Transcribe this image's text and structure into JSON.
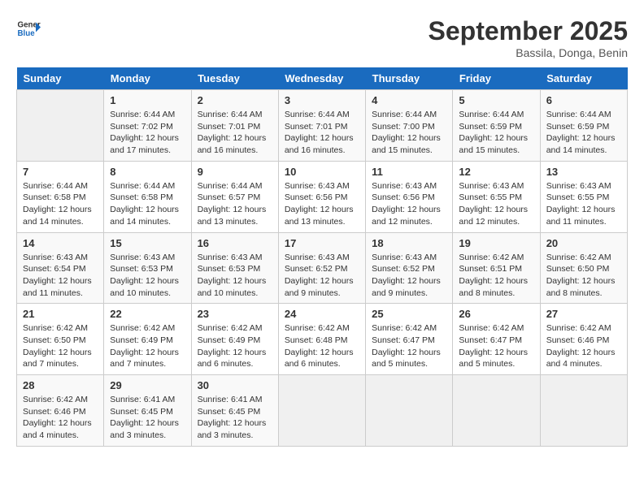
{
  "header": {
    "logo_line1": "General",
    "logo_line2": "Blue",
    "month": "September 2025",
    "location": "Bassila, Donga, Benin"
  },
  "days_of_week": [
    "Sunday",
    "Monday",
    "Tuesday",
    "Wednesday",
    "Thursday",
    "Friday",
    "Saturday"
  ],
  "weeks": [
    [
      {
        "num": "",
        "info": ""
      },
      {
        "num": "1",
        "info": "Sunrise: 6:44 AM\nSunset: 7:02 PM\nDaylight: 12 hours\nand 17 minutes."
      },
      {
        "num": "2",
        "info": "Sunrise: 6:44 AM\nSunset: 7:01 PM\nDaylight: 12 hours\nand 16 minutes."
      },
      {
        "num": "3",
        "info": "Sunrise: 6:44 AM\nSunset: 7:01 PM\nDaylight: 12 hours\nand 16 minutes."
      },
      {
        "num": "4",
        "info": "Sunrise: 6:44 AM\nSunset: 7:00 PM\nDaylight: 12 hours\nand 15 minutes."
      },
      {
        "num": "5",
        "info": "Sunrise: 6:44 AM\nSunset: 6:59 PM\nDaylight: 12 hours\nand 15 minutes."
      },
      {
        "num": "6",
        "info": "Sunrise: 6:44 AM\nSunset: 6:59 PM\nDaylight: 12 hours\nand 14 minutes."
      }
    ],
    [
      {
        "num": "7",
        "info": "Sunrise: 6:44 AM\nSunset: 6:58 PM\nDaylight: 12 hours\nand 14 minutes."
      },
      {
        "num": "8",
        "info": "Sunrise: 6:44 AM\nSunset: 6:58 PM\nDaylight: 12 hours\nand 14 minutes."
      },
      {
        "num": "9",
        "info": "Sunrise: 6:44 AM\nSunset: 6:57 PM\nDaylight: 12 hours\nand 13 minutes."
      },
      {
        "num": "10",
        "info": "Sunrise: 6:43 AM\nSunset: 6:56 PM\nDaylight: 12 hours\nand 13 minutes."
      },
      {
        "num": "11",
        "info": "Sunrise: 6:43 AM\nSunset: 6:56 PM\nDaylight: 12 hours\nand 12 minutes."
      },
      {
        "num": "12",
        "info": "Sunrise: 6:43 AM\nSunset: 6:55 PM\nDaylight: 12 hours\nand 12 minutes."
      },
      {
        "num": "13",
        "info": "Sunrise: 6:43 AM\nSunset: 6:55 PM\nDaylight: 12 hours\nand 11 minutes."
      }
    ],
    [
      {
        "num": "14",
        "info": "Sunrise: 6:43 AM\nSunset: 6:54 PM\nDaylight: 12 hours\nand 11 minutes."
      },
      {
        "num": "15",
        "info": "Sunrise: 6:43 AM\nSunset: 6:53 PM\nDaylight: 12 hours\nand 10 minutes."
      },
      {
        "num": "16",
        "info": "Sunrise: 6:43 AM\nSunset: 6:53 PM\nDaylight: 12 hours\nand 10 minutes."
      },
      {
        "num": "17",
        "info": "Sunrise: 6:43 AM\nSunset: 6:52 PM\nDaylight: 12 hours\nand 9 minutes."
      },
      {
        "num": "18",
        "info": "Sunrise: 6:43 AM\nSunset: 6:52 PM\nDaylight: 12 hours\nand 9 minutes."
      },
      {
        "num": "19",
        "info": "Sunrise: 6:42 AM\nSunset: 6:51 PM\nDaylight: 12 hours\nand 8 minutes."
      },
      {
        "num": "20",
        "info": "Sunrise: 6:42 AM\nSunset: 6:50 PM\nDaylight: 12 hours\nand 8 minutes."
      }
    ],
    [
      {
        "num": "21",
        "info": "Sunrise: 6:42 AM\nSunset: 6:50 PM\nDaylight: 12 hours\nand 7 minutes."
      },
      {
        "num": "22",
        "info": "Sunrise: 6:42 AM\nSunset: 6:49 PM\nDaylight: 12 hours\nand 7 minutes."
      },
      {
        "num": "23",
        "info": "Sunrise: 6:42 AM\nSunset: 6:49 PM\nDaylight: 12 hours\nand 6 minutes."
      },
      {
        "num": "24",
        "info": "Sunrise: 6:42 AM\nSunset: 6:48 PM\nDaylight: 12 hours\nand 6 minutes."
      },
      {
        "num": "25",
        "info": "Sunrise: 6:42 AM\nSunset: 6:47 PM\nDaylight: 12 hours\nand 5 minutes."
      },
      {
        "num": "26",
        "info": "Sunrise: 6:42 AM\nSunset: 6:47 PM\nDaylight: 12 hours\nand 5 minutes."
      },
      {
        "num": "27",
        "info": "Sunrise: 6:42 AM\nSunset: 6:46 PM\nDaylight: 12 hours\nand 4 minutes."
      }
    ],
    [
      {
        "num": "28",
        "info": "Sunrise: 6:42 AM\nSunset: 6:46 PM\nDaylight: 12 hours\nand 4 minutes."
      },
      {
        "num": "29",
        "info": "Sunrise: 6:41 AM\nSunset: 6:45 PM\nDaylight: 12 hours\nand 3 minutes."
      },
      {
        "num": "30",
        "info": "Sunrise: 6:41 AM\nSunset: 6:45 PM\nDaylight: 12 hours\nand 3 minutes."
      },
      {
        "num": "",
        "info": ""
      },
      {
        "num": "",
        "info": ""
      },
      {
        "num": "",
        "info": ""
      },
      {
        "num": "",
        "info": ""
      }
    ]
  ]
}
